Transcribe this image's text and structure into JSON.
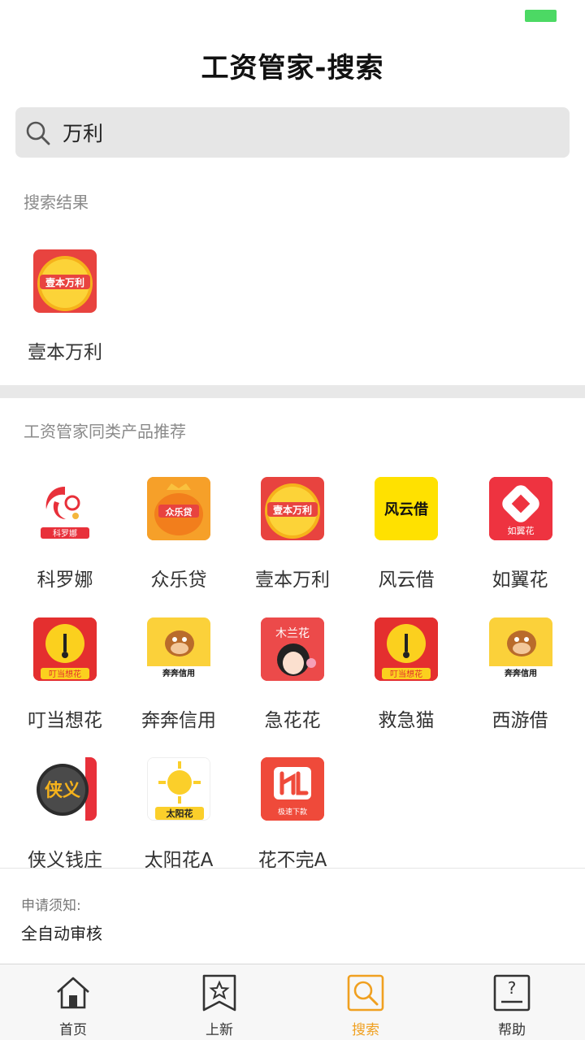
{
  "page": {
    "title": "工资管家-搜索"
  },
  "search": {
    "value": "万利",
    "icon": "search-icon"
  },
  "results": {
    "label": "搜索结果",
    "items": [
      {
        "name": "壹本万利",
        "icon_text": "壹本万利"
      }
    ]
  },
  "recommend": {
    "label": "工资管家同类产品推荐",
    "items": [
      {
        "name": "科罗娜",
        "icon_text": "科罗娜"
      },
      {
        "name": "众乐贷",
        "icon_text": "众乐贷"
      },
      {
        "name": "壹本万利",
        "icon_text": "壹本万利"
      },
      {
        "name": "风云借",
        "icon_text": "风云借"
      },
      {
        "name": "如翼花",
        "icon_text": "如翼花"
      },
      {
        "name": "叮当想花",
        "icon_text": "叮当想花"
      },
      {
        "name": "奔奔信用",
        "icon_text": "奔奔信用"
      },
      {
        "name": "急花花",
        "icon_text": "木兰花"
      },
      {
        "name": "救急猫",
        "icon_text": "叮当想花"
      },
      {
        "name": "西游借",
        "icon_text": "奔奔信用"
      },
      {
        "name": "侠义钱庄",
        "icon_text": "侠义"
      },
      {
        "name": "太阳花A",
        "icon_text": "太阳花"
      },
      {
        "name": "花不完A",
        "icon_text": "极速下款"
      }
    ]
  },
  "notice": {
    "title": "申请须知:",
    "body": "全自动审核"
  },
  "tabs": [
    {
      "label": "首页",
      "icon": "home-icon"
    },
    {
      "label": "上新",
      "icon": "star-bookmark-icon"
    },
    {
      "label": "搜索",
      "icon": "search-icon"
    },
    {
      "label": "帮助",
      "icon": "help-icon"
    }
  ],
  "colors": {
    "accent": "#f0a020",
    "battery": "#4cd964",
    "search_bg": "#e6e6e6"
  }
}
